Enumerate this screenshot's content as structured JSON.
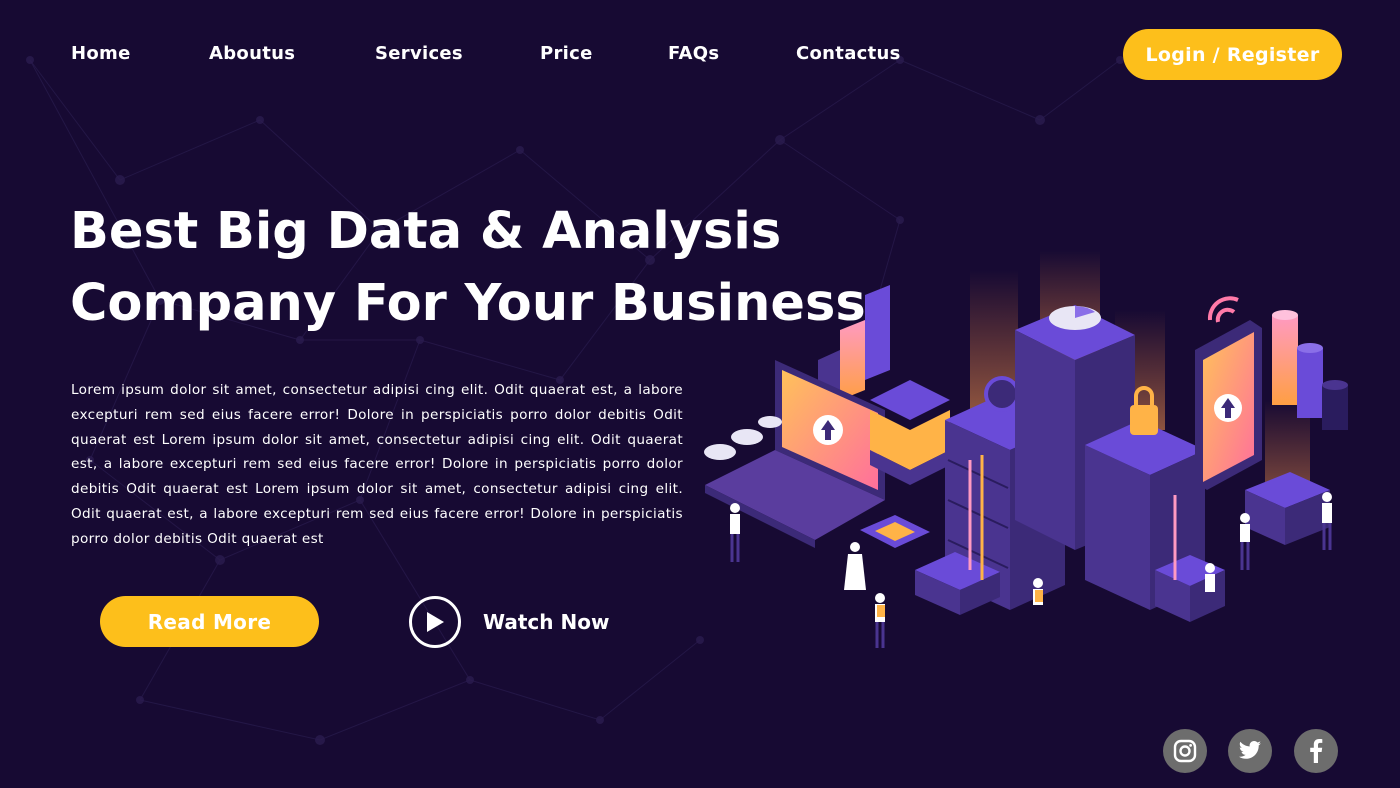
{
  "nav": {
    "links": [
      "Home",
      "Aboutus",
      "Services",
      "Price",
      "FAQs",
      "Contactus"
    ],
    "login_label": "Login / Register"
  },
  "hero": {
    "title_line1": "Best Big Data & Analysis",
    "title_line2": "Company For Your Business",
    "body": "Lorem ipsum dolor sit amet, consectetur adipisi cing elit. Odit quaerat est, a labore excepturi rem sed eius facere error! Dolore in perspiciatis porro dolor debitis Odit quaerat est Lorem ipsum dolor sit amet, consectetur adipisi cing elit. Odit quaerat est, a labore excepturi rem sed eius facere error! Dolore in perspiciatis porro dolor debitis Odit quaerat est Lorem ipsum dolor sit amet, consectetur adipisi cing elit. Odit quaerat est, a labore excepturi rem sed eius facere error! Dolore in perspiciatis porro dolor debitis Odit quaerat est",
    "read_more_label": "Read More",
    "watch_label": "Watch Now"
  },
  "social": {
    "icons": [
      "instagram-icon",
      "twitter-icon",
      "facebook-icon"
    ]
  },
  "colors": {
    "background": "#170a33",
    "accent_yellow": "#fdbf1b",
    "purple": "#5a3d9e",
    "social_bg": "#6d6d6d"
  }
}
